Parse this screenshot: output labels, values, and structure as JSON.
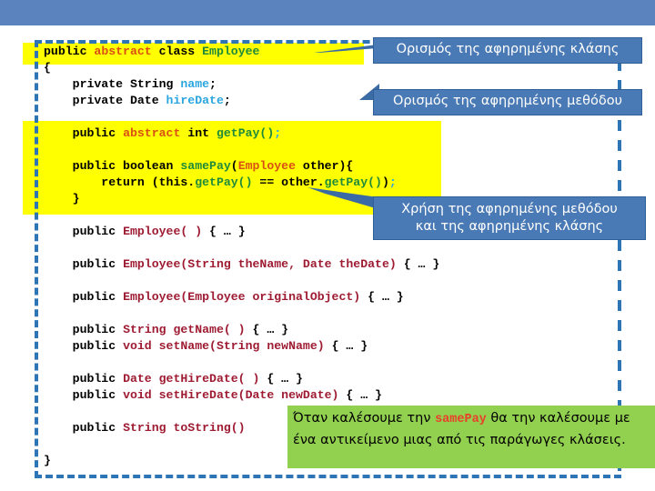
{
  "slide": {
    "top_bar_color": "#5b84be",
    "highlight_color": "#ffff00",
    "callout_color": "#4a7ab5",
    "note_color": "#92d050",
    "frame_color": "#2e75b6"
  },
  "code": {
    "lines": [
      [
        {
          "t": "public ",
          "c": "kw"
        },
        {
          "t": "abstract ",
          "c": "abs"
        },
        {
          "t": "class ",
          "c": "kw"
        },
        {
          "t": "Employee",
          "c": "green"
        }
      ],
      [
        {
          "t": "{",
          "c": "plain"
        }
      ],
      [
        {
          "t": "    private String ",
          "c": "kw"
        },
        {
          "t": "name",
          "c": "var"
        },
        {
          "t": ";",
          "c": "plain"
        }
      ],
      [
        {
          "t": "    private Date ",
          "c": "kw"
        },
        {
          "t": "hireDate",
          "c": "var"
        },
        {
          "t": ";",
          "c": "plain"
        }
      ],
      [],
      [
        {
          "t": "    public ",
          "c": "kw"
        },
        {
          "t": "abstract ",
          "c": "abs"
        },
        {
          "t": "int ",
          "c": "kw"
        },
        {
          "t": "getPay()",
          "c": "green"
        },
        {
          "t": ";",
          "c": "var"
        }
      ],
      [],
      [
        {
          "t": "    public boolean ",
          "c": "kw"
        },
        {
          "t": "samePay",
          "c": "green"
        },
        {
          "t": "(",
          "c": "plain"
        },
        {
          "t": "Employee",
          "c": "abs"
        },
        {
          "t": " other){",
          "c": "plain"
        }
      ],
      [
        {
          "t": "        return (this.",
          "c": "plain"
        },
        {
          "t": "getPay()",
          "c": "green"
        },
        {
          "t": " == other.",
          "c": "plain"
        },
        {
          "t": "getPay()",
          "c": "green"
        },
        {
          "t": ")",
          "c": "plain"
        },
        {
          "t": ";",
          "c": "var"
        }
      ],
      [
        {
          "t": "    }",
          "c": "plain"
        }
      ],
      [],
      [
        {
          "t": "    public ",
          "c": "kw"
        },
        {
          "t": "Employee( )",
          "c": "type"
        },
        {
          "t": " { … }",
          "c": "plain"
        }
      ],
      [],
      [
        {
          "t": "    public ",
          "c": "kw"
        },
        {
          "t": "Employee(String theName, Date theDate)",
          "c": "type"
        },
        {
          "t": " { … }",
          "c": "plain"
        }
      ],
      [],
      [
        {
          "t": "    public ",
          "c": "kw"
        },
        {
          "t": "Employee(Employee originalObject)",
          "c": "type"
        },
        {
          "t": " { … }",
          "c": "plain"
        }
      ],
      [],
      [
        {
          "t": "    public ",
          "c": "kw"
        },
        {
          "t": "String getName( )",
          "c": "type"
        },
        {
          "t": " { … }",
          "c": "plain"
        }
      ],
      [
        {
          "t": "    public ",
          "c": "kw"
        },
        {
          "t": "void setName(String newName)",
          "c": "type"
        },
        {
          "t": " { … }",
          "c": "plain"
        }
      ],
      [],
      [
        {
          "t": "    public ",
          "c": "kw"
        },
        {
          "t": "Date getHireDate( )",
          "c": "type"
        },
        {
          "t": " { … }",
          "c": "plain"
        }
      ],
      [
        {
          "t": "    public ",
          "c": "kw"
        },
        {
          "t": "void setHireDate(Date newDate)",
          "c": "type"
        },
        {
          "t": " { … }",
          "c": "plain"
        }
      ],
      [],
      [
        {
          "t": "    public ",
          "c": "kw"
        },
        {
          "t": "String toString()",
          "c": "type"
        }
      ],
      [],
      [
        {
          "t": "}",
          "c": "plain"
        }
      ]
    ]
  },
  "callouts": {
    "abstract_class": "Ορισμός της αφηρημένης κλάσης",
    "abstract_method": "Ορισμός της αφηρημένης μεθόδου",
    "usage_line1": "Χρήση της αφηρημένης μεθόδου",
    "usage_line2": "και της αφηρημένης κλάσης"
  },
  "note": {
    "part1": "Όταν καλέσουμε την ",
    "code": "samePay",
    "part2": " θα την καλέσουμε με ένα αντικείμενο μιας από τις παράγωγες κλάσεις."
  }
}
